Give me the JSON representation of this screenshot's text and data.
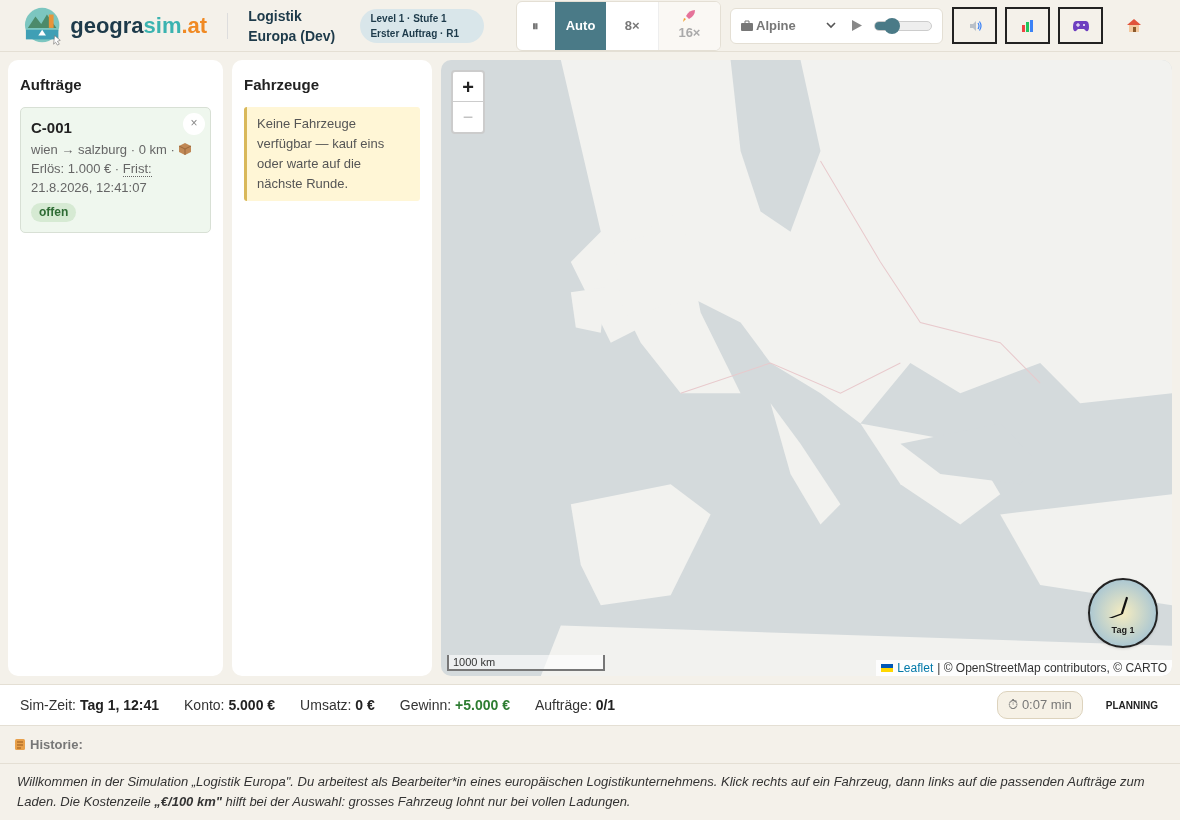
{
  "header": {
    "logo": {
      "part1": "geogra",
      "part2": "sim",
      "part3": ".at"
    },
    "title": "Logistik Europa (Dev)",
    "level_badge": "Level 1 · Stufe 1 Erster Auftrag · R1",
    "speed_buttons": [
      {
        "kind": "pause",
        "label": "⏸",
        "selected": false,
        "disabled": false
      },
      {
        "kind": "text",
        "label": "Auto",
        "selected": true,
        "disabled": false
      },
      {
        "kind": "text",
        "label": "8×",
        "selected": false,
        "disabled": false
      },
      {
        "kind": "rocket",
        "label": "16×",
        "selected": false,
        "disabled": true
      }
    ],
    "music": {
      "track": "Alpine",
      "level": 0.3
    },
    "tool_buttons": [
      {
        "kind": "speaker"
      },
      {
        "kind": "chart"
      },
      {
        "kind": "gamepad"
      },
      {
        "kind": "home"
      }
    ]
  },
  "orders_panel": {
    "title": "Aufträge",
    "orders": [
      {
        "id": "C-001",
        "route": "wien → salzburg · 0 km ·",
        "revenue": "Erlös: 1.000 € ·",
        "deadline_label": "Frist:",
        "deadline": "21.8.2026, 12:41:07",
        "status": "offen",
        "close": "×"
      }
    ]
  },
  "vehicles_panel": {
    "title": "Fahrzeuge",
    "notice": "Keine Fahrzeuge verfügbar — kauf eins oder warte auf die nächste Runde."
  },
  "map": {
    "kind": "picture",
    "zoom_in": "+",
    "zoom_out": "−",
    "scale": "1000 km",
    "attribution": {
      "link": "Leaflet",
      "text": "| © OpenStreetMap contributors, © CARTO"
    },
    "clock": {
      "label": "Tag 1"
    }
  },
  "status_bar": {
    "items": [
      {
        "label": "Sim-Zeit:",
        "value": "Tag 1, 12:41",
        "positive": false
      },
      {
        "label": "Konto:",
        "value": "5.000 €",
        "positive": false
      },
      {
        "label": "Umsatz:",
        "value": "0 €",
        "positive": false
      },
      {
        "label": "Gewinn:",
        "value": "+5.000 €",
        "positive": true
      },
      {
        "label": "Aufträge:",
        "value": "0/1",
        "positive": false
      }
    ],
    "timer": "⏱ 0:07 min",
    "phase": "PLANNING"
  },
  "history": {
    "title": "Historie:",
    "message": "Willkommen in der Simulation „Logistik Europa\". Du arbeitest als Bearbeiter*in eines europäischen Logistikunternehmens. Klick rechts auf ein Fahrzeug, dann links auf die passenden Aufträge zum Laden. Die Kostenzeile **„€/100 km\"** hilft bei der Auswahl: grosses Fahrzeug lohnt nur bei vollen Ladungen."
  }
}
